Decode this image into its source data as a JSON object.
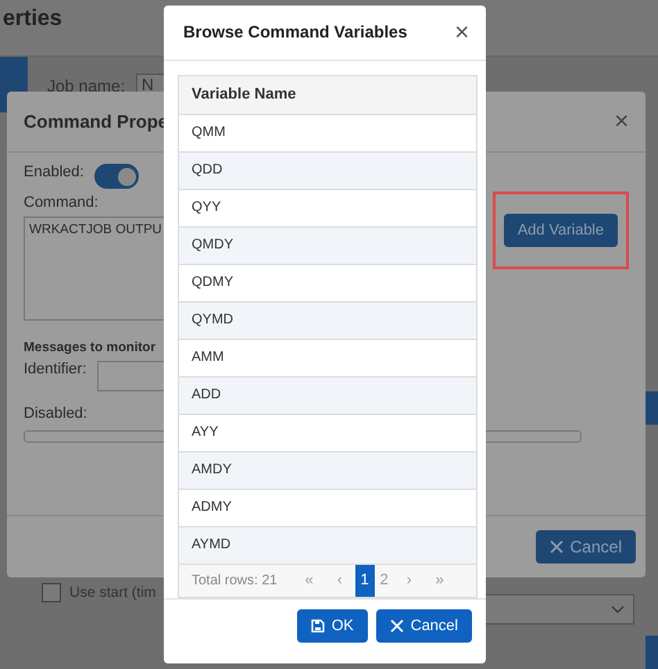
{
  "page": {
    "title": "erties",
    "job_label": "Job name:",
    "job_value": "N",
    "use_start_label": "Use start (tim",
    "use_start_checked": false
  },
  "properties_dialog": {
    "title": "Command Prope",
    "enabled_label": "Enabled:",
    "enabled": true,
    "command_label": "Command:",
    "command_value": "WRKACTJOB OUTPU",
    "add_variable": "Add Variable",
    "messages_heading": "Messages to monitor",
    "identifier_label": "Identifier:",
    "disabled_label": "Disabled:",
    "cancel": "Cancel",
    "close": "×"
  },
  "browse_dialog": {
    "title": "Browse Command Variables",
    "close": "×",
    "column": "Variable Name",
    "rows": [
      "QMM",
      "QDD",
      "QYY",
      "QMDY",
      "QDMY",
      "QYMD",
      "AMM",
      "ADD",
      "AYY",
      "AMDY",
      "ADMY",
      "AYMD"
    ],
    "total": "Total rows: 21",
    "first": "«",
    "prev": "‹",
    "next": "›",
    "last": "»",
    "pages": [
      {
        "label": "1",
        "selected": true
      },
      {
        "label": "2",
        "selected": false
      }
    ],
    "ok": "OK",
    "cancel": "Cancel"
  }
}
